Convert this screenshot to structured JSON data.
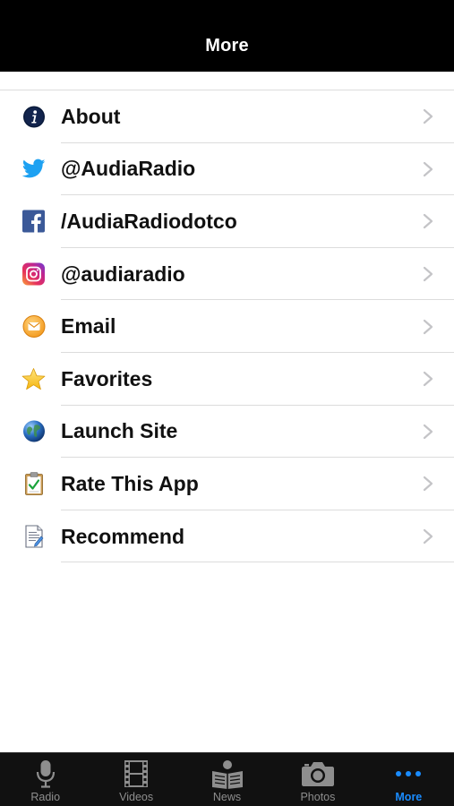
{
  "navbar": {
    "title": "More"
  },
  "menu": {
    "items": [
      {
        "label": "About",
        "icon": "info-icon"
      },
      {
        "label": "@AudiaRadio",
        "icon": "twitter-icon"
      },
      {
        "label": "/AudiaRadiodotco",
        "icon": "facebook-icon"
      },
      {
        "label": "@audiaradio",
        "icon": "instagram-icon"
      },
      {
        "label": "Email",
        "icon": "email-icon"
      },
      {
        "label": "Favorites",
        "icon": "star-icon"
      },
      {
        "label": "Launch Site",
        "icon": "globe-icon"
      },
      {
        "label": "Rate This App",
        "icon": "clipboard-icon"
      },
      {
        "label": "Recommend",
        "icon": "document-icon"
      }
    ]
  },
  "tabbar": {
    "tabs": [
      {
        "label": "Radio",
        "icon": "microphone-icon"
      },
      {
        "label": "Videos",
        "icon": "film-icon"
      },
      {
        "label": "News",
        "icon": "newspaper-icon"
      },
      {
        "label": "Photos",
        "icon": "camera-icon"
      },
      {
        "label": "More",
        "icon": "more-dots-icon",
        "active": true
      }
    ]
  },
  "colors": {
    "navbar_bg": "#000000",
    "tabbar_bg": "#111111",
    "active_tab": "#1a8cff",
    "inactive_tab": "#8e8e8e",
    "twitter": "#1da1f2",
    "facebook": "#3b5998"
  }
}
